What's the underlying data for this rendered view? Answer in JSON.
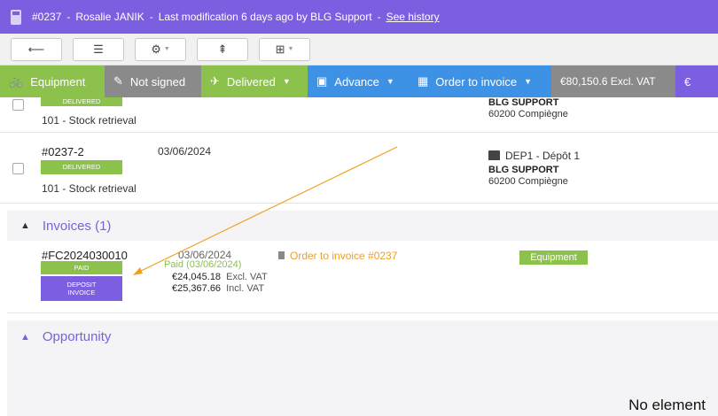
{
  "header": {
    "order_number": "#0237",
    "separator": "-",
    "customer": "Rosalie JANIK",
    "modification": "Last modification 6 days ago by BLG Support",
    "history_link": "See history"
  },
  "toolbar": {
    "buttons": [
      {
        "icon": "back-arrow-icon",
        "glyph": "⟵"
      },
      {
        "icon": "list-icon",
        "glyph": "☰"
      },
      {
        "icon": "document-settings-icon",
        "glyph": "⚙"
      },
      {
        "icon": "upload-top-icon",
        "glyph": "⇞"
      },
      {
        "icon": "split-icon",
        "glyph": "⊞"
      }
    ]
  },
  "actions": {
    "equipment": "Equipment",
    "not_signed": "Not signed",
    "delivered": "Delivered",
    "advance": "Advance",
    "order_to_invoice": "Order to invoice",
    "price": "€80,150.6 Excl. VAT",
    "euro_symbol": "€"
  },
  "deliveries": [
    {
      "status": "DELIVERED",
      "type": "101 - Stock retrieval",
      "company": "BLG SUPPORT",
      "city": "60200 Compiègne"
    },
    {
      "number": "#0237-2",
      "date": "03/06/2024",
      "status": "DELIVERED",
      "type": "101 - Stock retrieval",
      "depot": "DEP1 - Dépôt 1",
      "company": "BLG SUPPORT",
      "city": "60200 Compiègne"
    }
  ],
  "invoices_section": {
    "title": "Invoices (1)"
  },
  "invoice": {
    "number": "#FC2024030010",
    "date": "03/06/2024",
    "paid_badge": "PAID",
    "deposit_badge": "DEPOSIT INVOICE",
    "paid_text": "Paid (03/06/2024)",
    "excl_amount": "€24,045.18",
    "excl_label": "Excl. VAT",
    "incl_amount": "€25,367.66",
    "incl_label": "Incl. VAT",
    "order_link": "Order to invoice #0237",
    "category": "Equipment"
  },
  "opportunity_section": {
    "title": "Opportunity",
    "empty_text": "No element"
  },
  "colors": {
    "purple": "#7c5ee0",
    "green": "#8cc14c",
    "blue": "#3d92e6",
    "grey": "#8a8a8a",
    "orange": "#f0a020"
  }
}
